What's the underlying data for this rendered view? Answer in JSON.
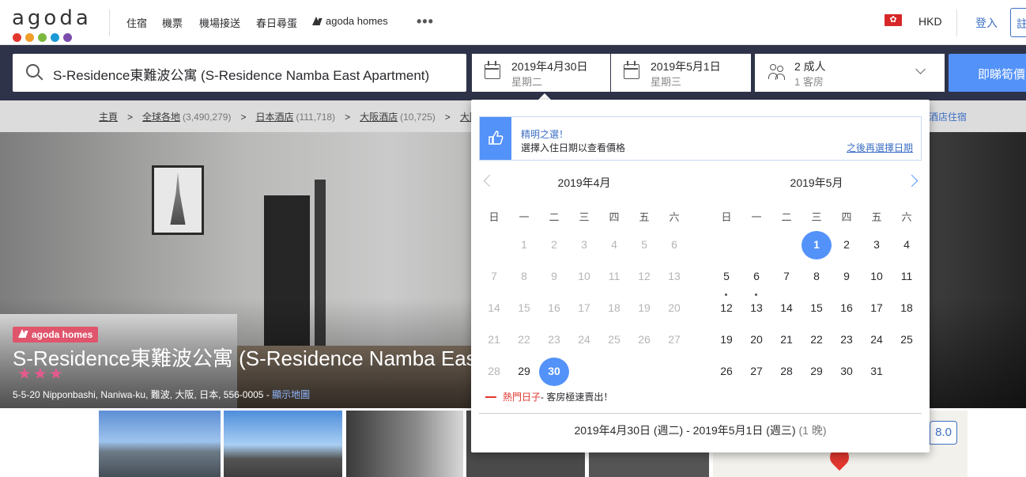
{
  "topnav": {
    "logo_text": "agoda",
    "logo_colors": [
      "#e1372e",
      "#f19d2a",
      "#7cb83e",
      "#1c9ad6",
      "#7a4dab"
    ],
    "links": [
      "住宿",
      "機票",
      "機場接送",
      "春日尋蛋"
    ],
    "homes_link": "agoda homes",
    "more": "•••",
    "flag_icon": "hong-kong-flag-icon",
    "currency": "HKD",
    "login": "登入",
    "signup": "註"
  },
  "search": {
    "query": "S-Residence東難波公寓 (S-Residence Namba East Apartment)",
    "checkin": {
      "date": "2019年4月30日",
      "weekday": "星期二"
    },
    "checkout": {
      "date": "2019年5月1日",
      "weekday": "星期三"
    },
    "guests": {
      "adults": "2 成人",
      "rooms": "1 客房"
    },
    "button": "即睇筍價"
  },
  "breadcrumb": {
    "items": [
      {
        "label": "主頁",
        "count": ""
      },
      {
        "label": "全球各地",
        "count": "(3,490,279)"
      },
      {
        "label": "日本酒店",
        "count": "(111,718)"
      },
      {
        "label": "大阪酒店",
        "count": "(10,725)"
      },
      {
        "label": "大阪",
        "count": ""
      }
    ],
    "separator": ">",
    "right_link": "酒店住宿"
  },
  "hotel": {
    "badge": "agoda homes",
    "name": "S-Residence東難波公寓 (S-Residence Namba East Apartment)",
    "stars": 3,
    "stars_text": "★★★",
    "address": "5-5-20 Nipponbashi, Naniwa-ku, 難波, 大阪, 日本, 556-0005 -",
    "map_link": "顯示地圖",
    "review_score": "8.0"
  },
  "datepicker": {
    "tip_title": "精明之選！",
    "tip_text": "選擇入住日期以查看價格",
    "tip_later": "之後再選擇日期",
    "weekdays": [
      "日",
      "一",
      "二",
      "三",
      "四",
      "五",
      "六"
    ],
    "months": [
      {
        "title": "2019年4月",
        "first_weekday": 1,
        "days": 30,
        "enabled_from": 29,
        "selected": [
          30
        ],
        "hot": []
      },
      {
        "title": "2019年5月",
        "first_weekday": 3,
        "days": 31,
        "enabled_from": 1,
        "selected": [
          1
        ],
        "hot": [
          12,
          13
        ]
      }
    ],
    "hot_label": "熱門日子",
    "hot_desc": " - 客房極速賣出！",
    "summary": "2019年4月30日 (週二) - 2019年5月1日 (週三)",
    "nights": "(1 晚)"
  }
}
